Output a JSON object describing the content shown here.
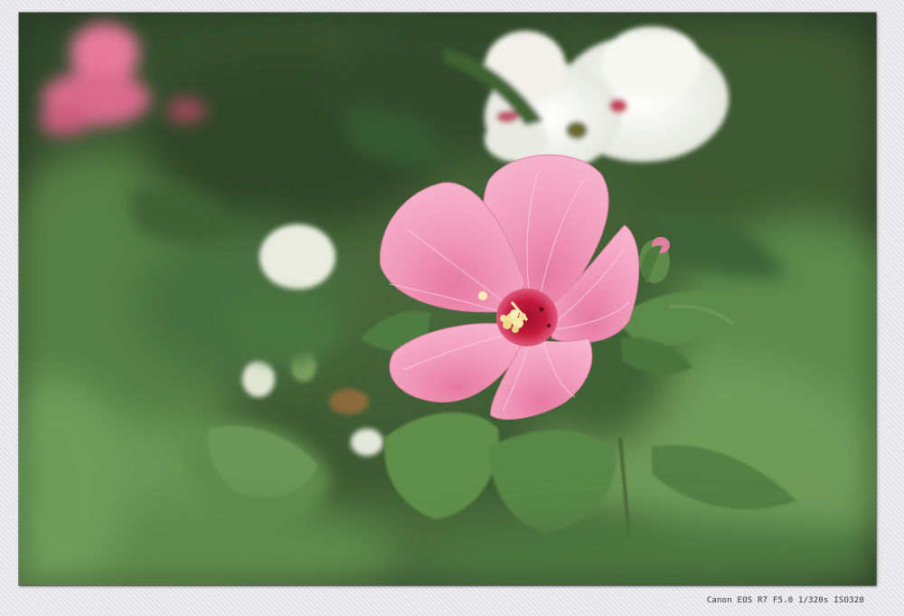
{
  "photo": {
    "subject": "flower-photo",
    "exif_caption": "Canon EOS R7 F5.0 1/320s ISO320"
  },
  "colors": {
    "frame_background": "#e6e6ea",
    "foliage_dark": "#2f4a29",
    "foliage_mid": "#4f7a41",
    "foliage_light": "#8fb57a",
    "petal_pink": "#f08fb2",
    "petal_highlight": "#f9c3d6",
    "flower_center_red": "#c41a3c",
    "stamen_yellow": "#f3e39a",
    "white_flower": "#f4f4ee"
  }
}
